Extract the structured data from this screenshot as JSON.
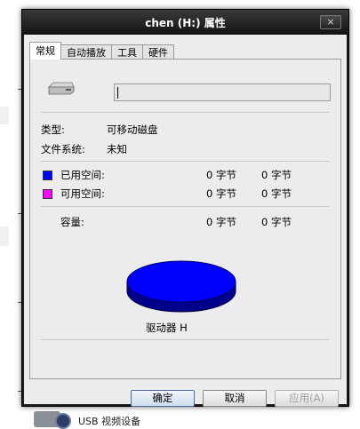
{
  "window": {
    "title": "chen (H:) 属性",
    "close_label": "×"
  },
  "tabs": [
    {
      "label": "常规",
      "active": true
    },
    {
      "label": "自动播放",
      "active": false
    },
    {
      "label": "工具",
      "active": false
    },
    {
      "label": "硬件",
      "active": false
    }
  ],
  "general": {
    "name_value": "",
    "type_label": "类型:",
    "type_value": "可移动磁盘",
    "fs_label": "文件系统:",
    "fs_value": "未知",
    "used_label": "已用空间:",
    "used_bytes": "0 字节",
    "used_size": "0 字节",
    "free_label": "可用空间:",
    "free_bytes": "0 字节",
    "free_size": "0 字节",
    "capacity_label": "容量:",
    "capacity_bytes": "0 字节",
    "capacity_size": "0 字节",
    "drive_label": "驱动器 H"
  },
  "colors": {
    "used": "#0000ff",
    "free": "#ff00ff",
    "pie_top": "#0000ff",
    "pie_side": "#00008b"
  },
  "buttons": {
    "ok": "确定",
    "cancel": "取消",
    "apply": "应用(A)"
  },
  "background": {
    "taskbar_label": "USB 视频设备"
  }
}
